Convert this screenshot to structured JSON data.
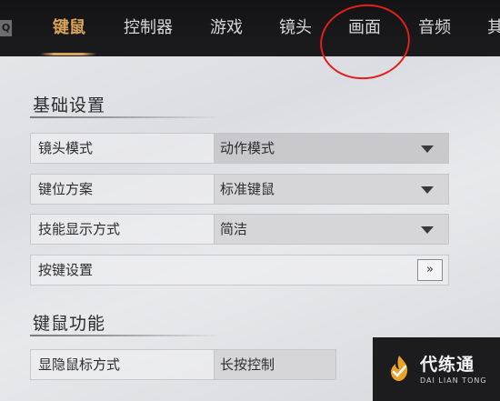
{
  "topbar": {
    "q_key": "Q",
    "tabs": [
      {
        "label": "键鼠",
        "active": true
      },
      {
        "label": "控制器",
        "active": false
      },
      {
        "label": "游戏",
        "active": false
      },
      {
        "label": "镜头",
        "active": false
      },
      {
        "label": "画面",
        "active": false
      },
      {
        "label": "音频",
        "active": false
      },
      {
        "label": "其",
        "active": false
      }
    ],
    "active_color": "#d9a45a",
    "annotation_color": "#e0201b"
  },
  "basic": {
    "title": "基础设置",
    "rows": [
      {
        "label": "镜头模式",
        "value": "动作模式",
        "control": "dropdown"
      },
      {
        "label": "键位方案",
        "value": "标准键鼠",
        "control": "dropdown"
      },
      {
        "label": "技能显示方式",
        "value": "简洁",
        "control": "dropdown"
      },
      {
        "label": "按键设置",
        "button": "»",
        "control": "button"
      }
    ]
  },
  "mouse": {
    "title": "键鼠功能",
    "rows": [
      {
        "label": "显隐鼠标方式",
        "value": "长按控制"
      }
    ]
  },
  "watermark": {
    "name": "代练通",
    "sub": "DAI LIAN TONG",
    "logo_icon": "flame-check-logo"
  }
}
